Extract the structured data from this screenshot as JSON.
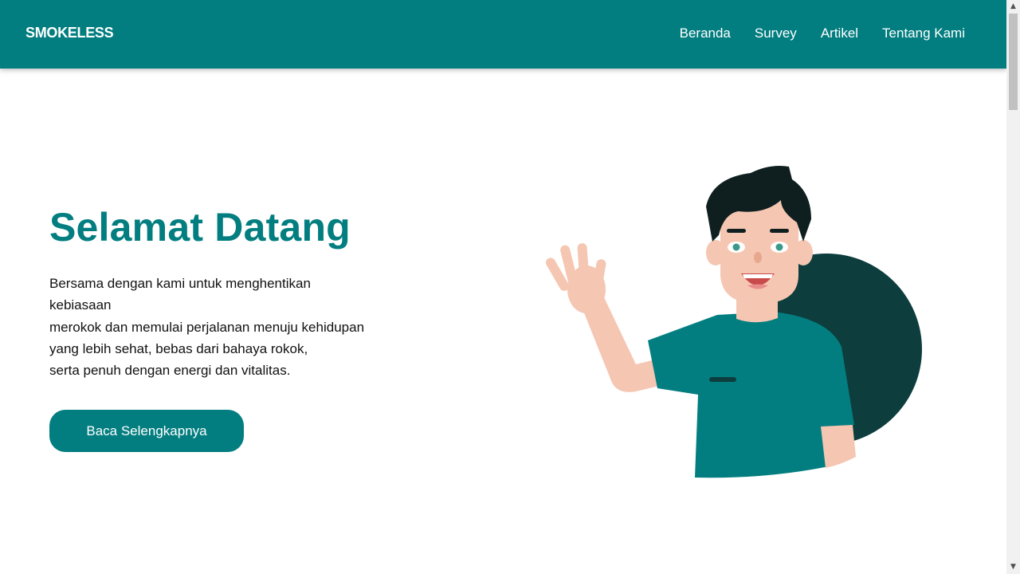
{
  "navbar": {
    "brand": "SMOKELESS",
    "links": [
      "Beranda",
      "Survey",
      "Artikel",
      "Tentang Kami"
    ]
  },
  "hero": {
    "title": "Selamat Datang",
    "text_lines": [
      "Bersama dengan kami untuk menghentikan",
      "kebiasaan",
      "merokok dan memulai perjalanan menuju kehidupan",
      "yang lebih sehat, bebas dari bahaya rokok,",
      "serta penuh dengan energi dan vitalitas."
    ],
    "cta_label": "Baca Selengkapnya"
  },
  "colors": {
    "primary": "#037e80",
    "dark_circle": "#0d3d3d",
    "skin": "#f5c6b2",
    "hair": "#0f1f1f"
  },
  "icons": {
    "scroll_up": "triangle-up-icon",
    "scroll_down": "triangle-down-icon"
  }
}
